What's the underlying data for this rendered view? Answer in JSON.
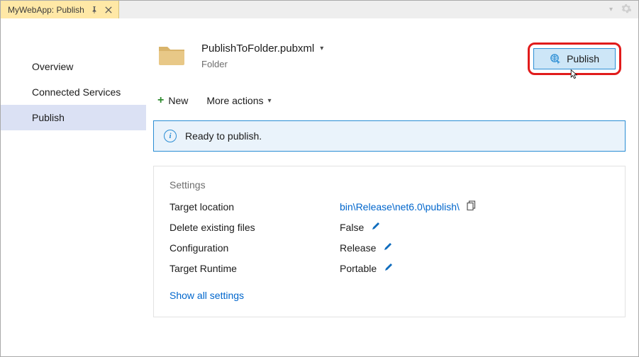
{
  "titlebar": {
    "tab_title": "MyWebApp: Publish"
  },
  "sidebar": {
    "items": [
      {
        "label": "Overview"
      },
      {
        "label": "Connected Services"
      },
      {
        "label": "Publish"
      }
    ],
    "active_index": 2
  },
  "profile": {
    "file_name": "PublishToFolder.pubxml",
    "subtitle": "Folder",
    "publish_button": "Publish"
  },
  "actions": {
    "new_label": "New",
    "more_actions_label": "More actions"
  },
  "status": {
    "message": "Ready to publish."
  },
  "settings": {
    "heading": "Settings",
    "rows": [
      {
        "label": "Target location",
        "value": "bin\\Release\\net6.0\\publish\\",
        "link": true,
        "copy": true
      },
      {
        "label": "Delete existing files",
        "value": "False",
        "edit": true
      },
      {
        "label": "Configuration",
        "value": "Release",
        "edit": true
      },
      {
        "label": "Target Runtime",
        "value": "Portable",
        "edit": true
      }
    ],
    "show_all": "Show all settings"
  }
}
